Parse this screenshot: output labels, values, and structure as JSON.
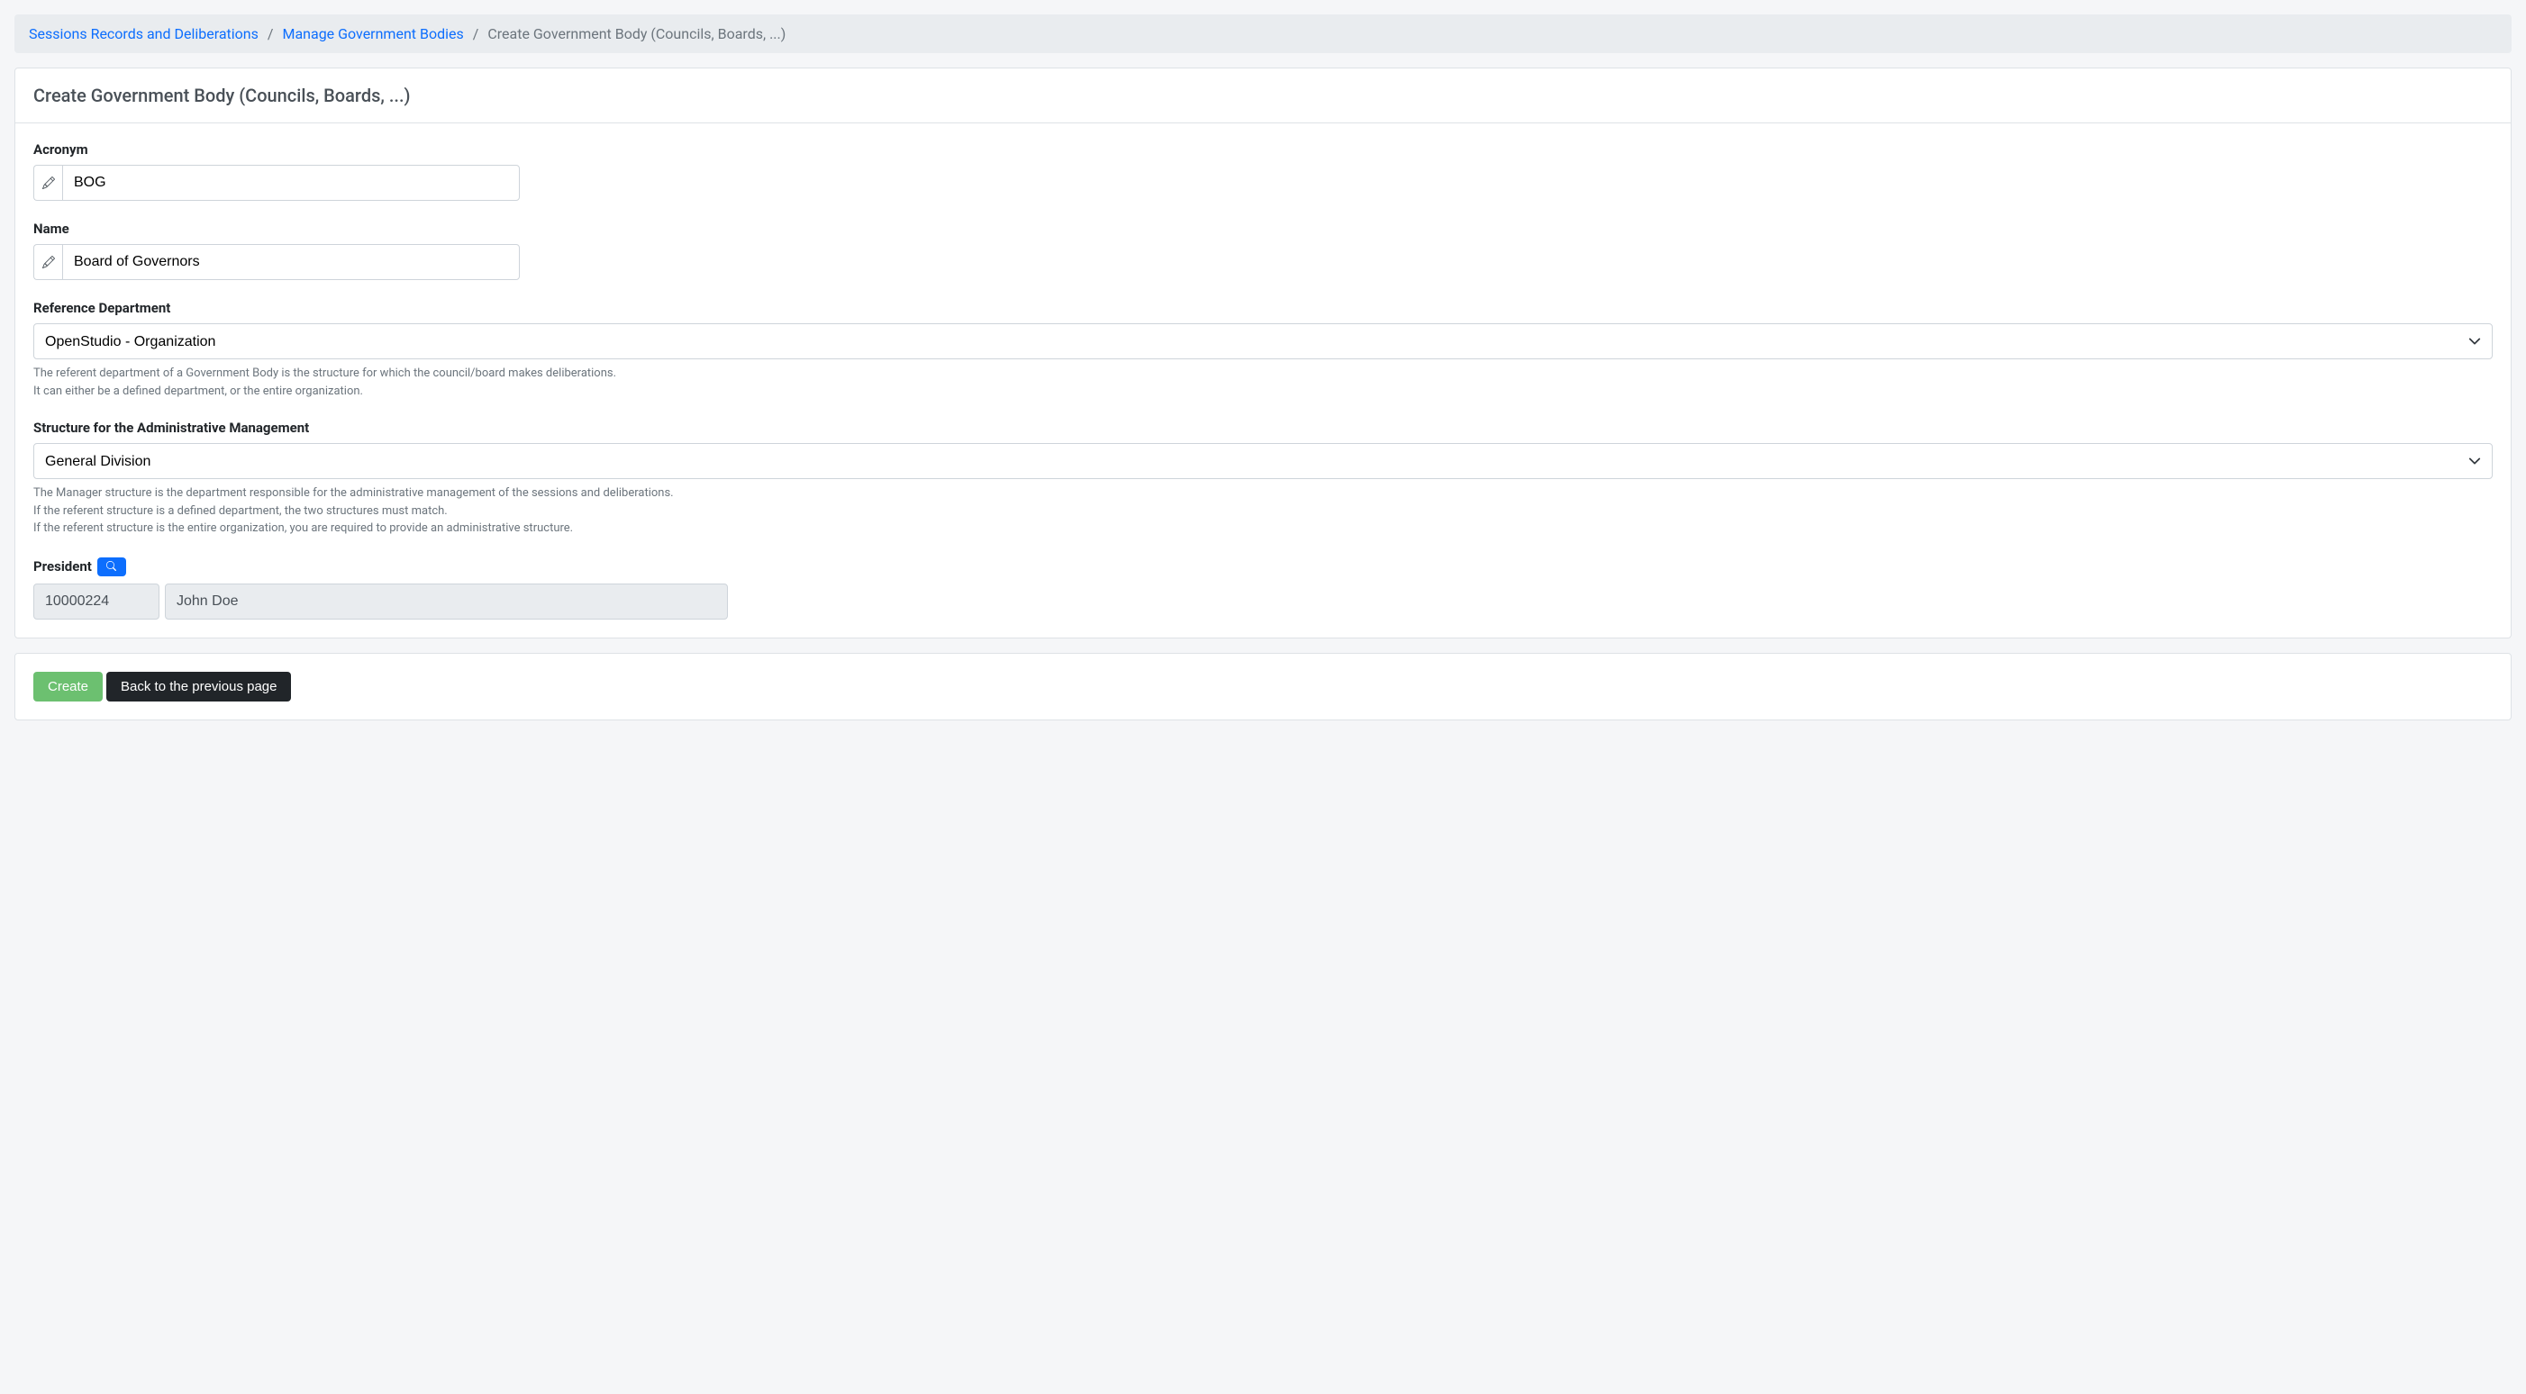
{
  "breadcrumb": {
    "items": [
      {
        "label": "Sessions Records and Deliberations"
      },
      {
        "label": "Manage Government Bodies"
      }
    ],
    "current": "Create Government Body (Councils, Boards, ...)"
  },
  "form": {
    "title": "Create Government Body (Councils, Boards, ...)",
    "acronym": {
      "label": "Acronym",
      "value": "BOG"
    },
    "name": {
      "label": "Name",
      "value": "Board of Governors"
    },
    "reference_department": {
      "label": "Reference Department",
      "value": "OpenStudio - Organization",
      "help1": "The referent department of a Government Body is the structure for which the council/board makes deliberations.",
      "help2": "It can either be a defined department, or the entire organization."
    },
    "admin_structure": {
      "label": "Structure for the Administrative Management",
      "value": "General Division",
      "help1": "The Manager structure is the department responsible for the administrative management of the sessions and deliberations.",
      "help2": "If the referent structure is a defined department, the two structures must match.",
      "help3": "If the referent structure is the entire organization, you are required to provide an administrative structure."
    },
    "president": {
      "label": "President",
      "id": "10000224",
      "name": "John Doe"
    }
  },
  "buttons": {
    "create": "Create",
    "back": "Back to the previous page"
  }
}
